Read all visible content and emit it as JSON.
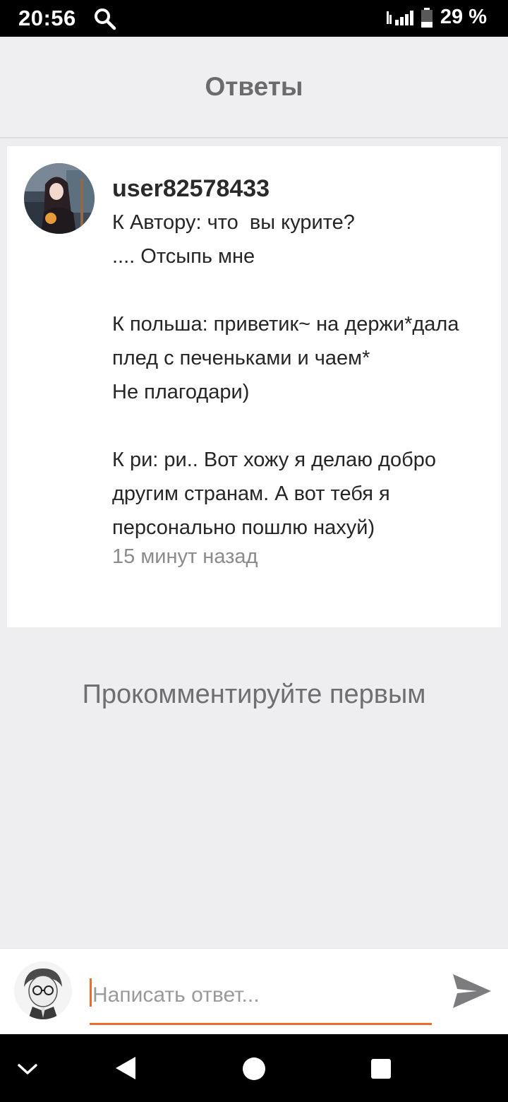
{
  "status_bar": {
    "time": "20:56",
    "battery": "29 %",
    "icons": [
      "search-icon",
      "wifi-signal-icon",
      "cell-signal-icon",
      "battery-icon"
    ]
  },
  "header": {
    "title": "Ответы"
  },
  "comment": {
    "username": "user82578433",
    "text": "К Автору: что  вы курите?\n.... Отсыпь мне\n\nК польша: приветик~ на держи*дала плед с печеньками и чаем*\nНе плагодари)\n\nК ри: ри.. Вот хожу я делаю добро другим странам. А вот тебя я персонально пошлю нахуй)",
    "time": "15 минут назад"
  },
  "empty_state": {
    "text": "Прокомментируйте первым"
  },
  "reply": {
    "placeholder": "Написать ответ...",
    "value": ""
  },
  "colors": {
    "accent": "#ef6b25",
    "background": "#eeedf0",
    "header_text": "#6b6b6e"
  },
  "nav_bar": {
    "icons": [
      "chevron-down-icon",
      "back-icon",
      "home-icon",
      "recents-icon"
    ]
  }
}
